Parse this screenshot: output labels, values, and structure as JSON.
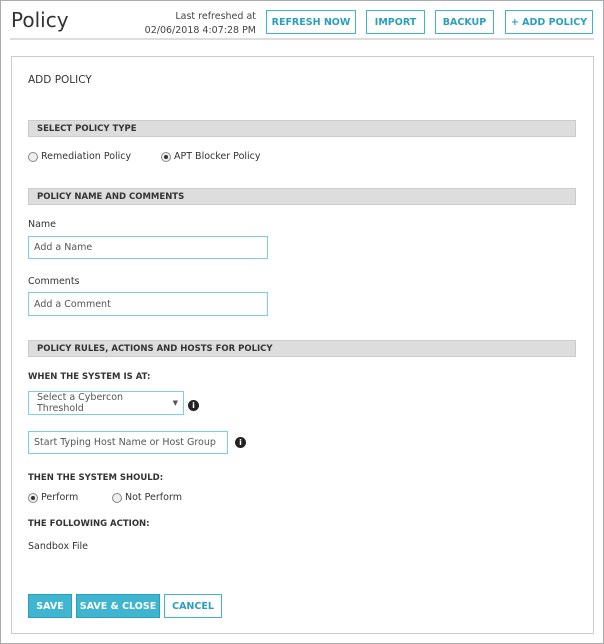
{
  "header": {
    "title": "Policy",
    "refresh_label": "Last refreshed at",
    "refresh_time": "02/06/2018 4:07:28 PM",
    "buttons": {
      "refresh": "REFRESH NOW",
      "import": "IMPORT",
      "backup": "BACKUP",
      "add": "+ ADD POLICY"
    }
  },
  "form": {
    "title": "ADD POLICY",
    "section_type": "SELECT POLICY TYPE",
    "type_options": [
      "Remediation Policy",
      "APT Blocker Policy"
    ],
    "type_selected": "APT Blocker Policy",
    "section_name": "POLICY NAME AND COMMENTS",
    "name_label": "Name",
    "name_placeholder": "Add a Name",
    "comments_label": "Comments",
    "comments_placeholder": "Add a Comment",
    "section_rules": "POLICY RULES, ACTIONS AND HOSTS FOR POLICY",
    "when_label": "WHEN THE SYSTEM IS AT:",
    "threshold_select": "Select a Cybercon Threshold",
    "host_placeholder": "Start Typing Host Name or Host Group",
    "then_label": "THEN THE SYSTEM SHOULD:",
    "then_options": [
      "Perform",
      "Not Perform"
    ],
    "then_selected": "Perform",
    "action_label": "THE FOLLOWING ACTION:",
    "action_value": "Sandbox File",
    "buttons": {
      "save": "SAVE",
      "save_close": "SAVE & CLOSE",
      "cancel": "CANCEL"
    }
  }
}
